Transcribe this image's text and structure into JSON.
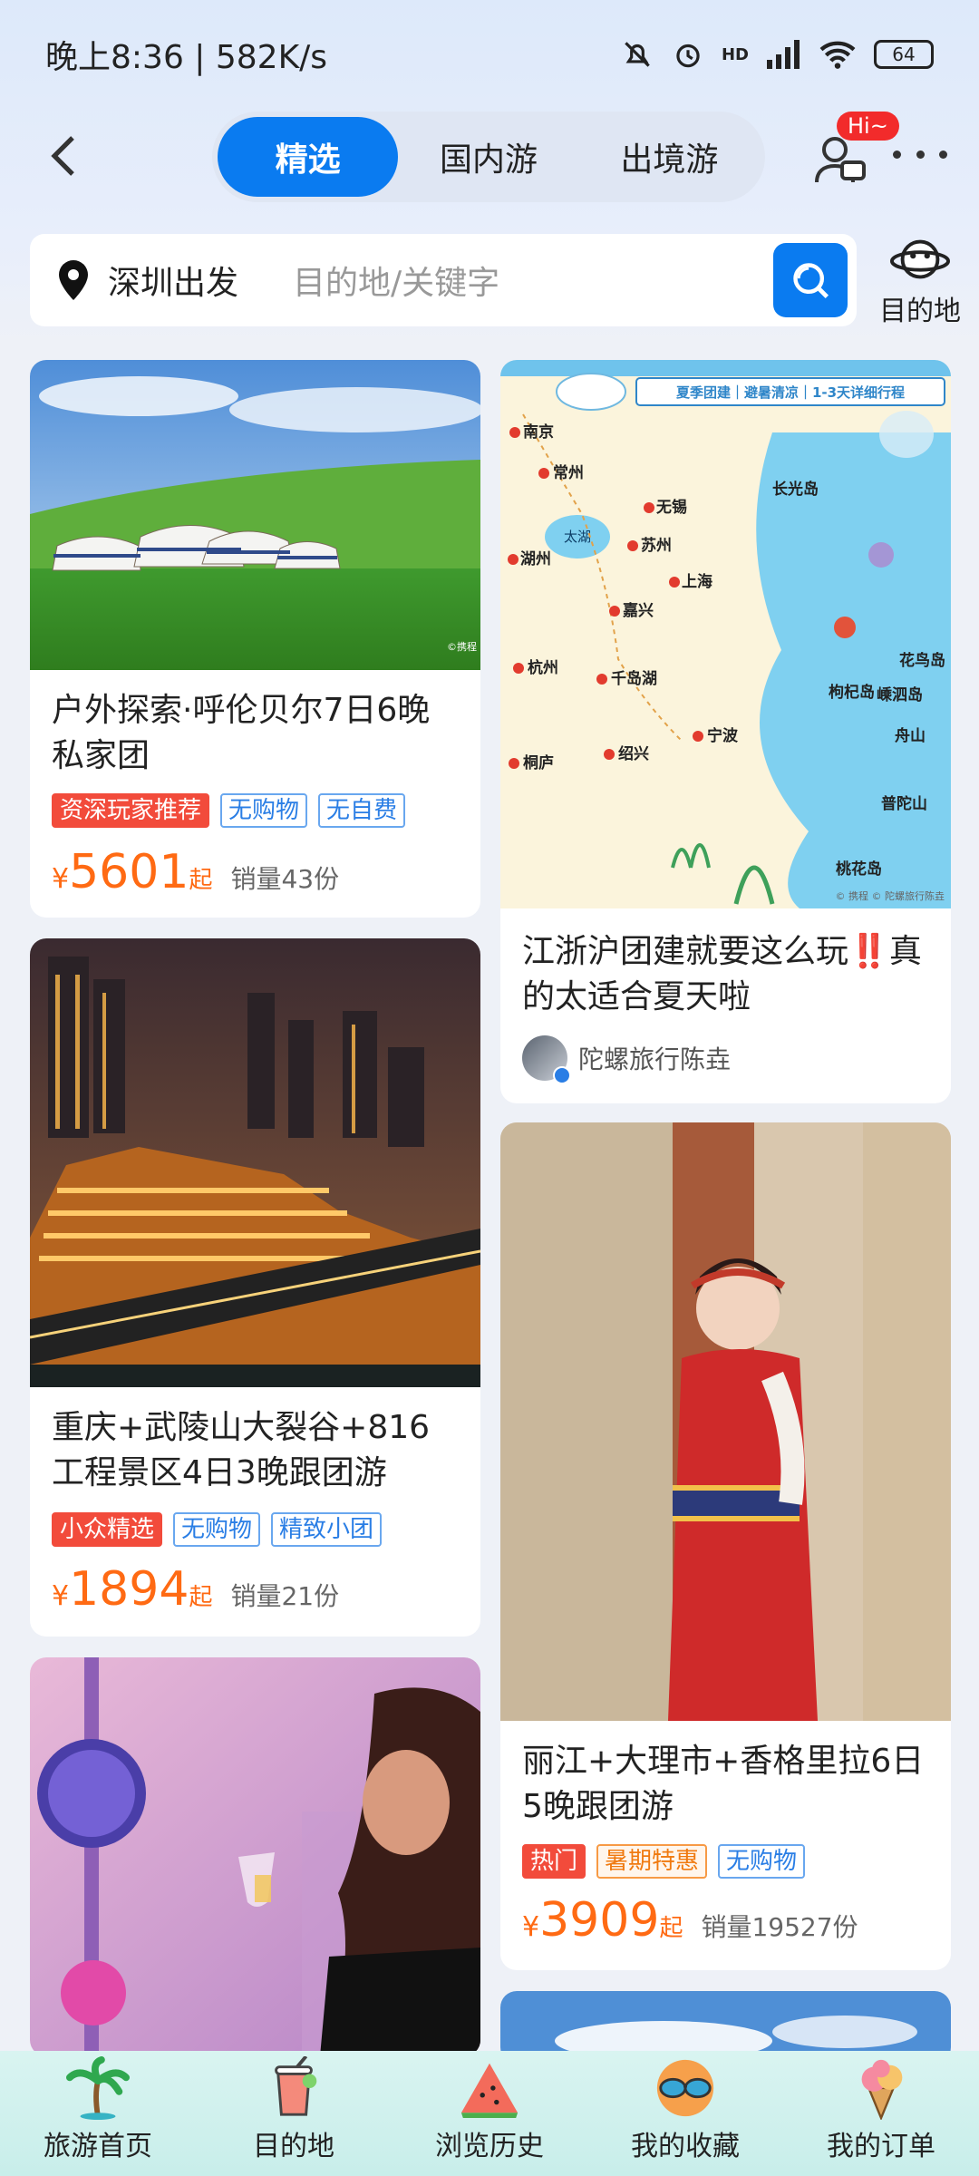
{
  "status_bar": {
    "time": "晚上8:36 | 582K/s",
    "battery": "64",
    "network": "HD"
  },
  "header": {
    "tabs": [
      {
        "label": "精选",
        "active": true
      },
      {
        "label": "国内游",
        "active": false
      },
      {
        "label": "出境游",
        "active": false
      }
    ],
    "hi_badge": "Hi~"
  },
  "search": {
    "departure": "深圳出发",
    "placeholder": "目的地/关键字",
    "dest_label": "目的地"
  },
  "cards": {
    "c1": {
      "title": "户外探索·呼伦贝尔7日6晚私家团",
      "tags": [
        "资深玩家推荐",
        "无购物",
        "无自费"
      ],
      "yen": "¥",
      "price": "5601",
      "qi": "起",
      "sales": "销量43份",
      "credit": "©携程"
    },
    "c2": {
      "title": "江浙沪团建就要这么玩‼️真的太适合夏天啦",
      "author": "陀螺旅行陈垚",
      "map_banner": "夏季团建｜避暑清凉｜1-3天详细行程",
      "cities": [
        "南京",
        "常州",
        "无锡",
        "苏州",
        "湖州",
        "嘉兴",
        "上海",
        "杭州",
        "千岛湖",
        "宁波",
        "桐庐",
        "绍兴",
        "舟山",
        "花鸟岛",
        "嵊泗岛",
        "长光岛",
        "枸杞岛",
        "桃花岛",
        "太湖",
        "普陀山"
      ],
      "credit": "© 携程 © 陀螺旅行陈垚"
    },
    "c3": {
      "title": "重庆+武陵山大裂谷+816工程景区4日3晚跟团游",
      "tags": [
        "小众精选",
        "无购物",
        "精致小团"
      ],
      "yen": "¥",
      "price": "1894",
      "qi": "起",
      "sales": "销量21份"
    },
    "c4": {
      "title": "丽江+大理市+香格里拉6日5晚跟团游",
      "tags": [
        "热门",
        "暑期特惠",
        "无购物"
      ],
      "yen": "¥",
      "price": "3909",
      "qi": "起",
      "sales": "销量19527份"
    }
  },
  "bottom_nav": [
    {
      "label": "旅游首页",
      "icon": "palm-tree-icon"
    },
    {
      "label": "目的地",
      "icon": "drink-cup-icon"
    },
    {
      "label": "浏览历史",
      "icon": "watermelon-icon"
    },
    {
      "label": "我的收藏",
      "icon": "sunglasses-icon"
    },
    {
      "label": "我的订单",
      "icon": "ice-cream-icon"
    }
  ]
}
